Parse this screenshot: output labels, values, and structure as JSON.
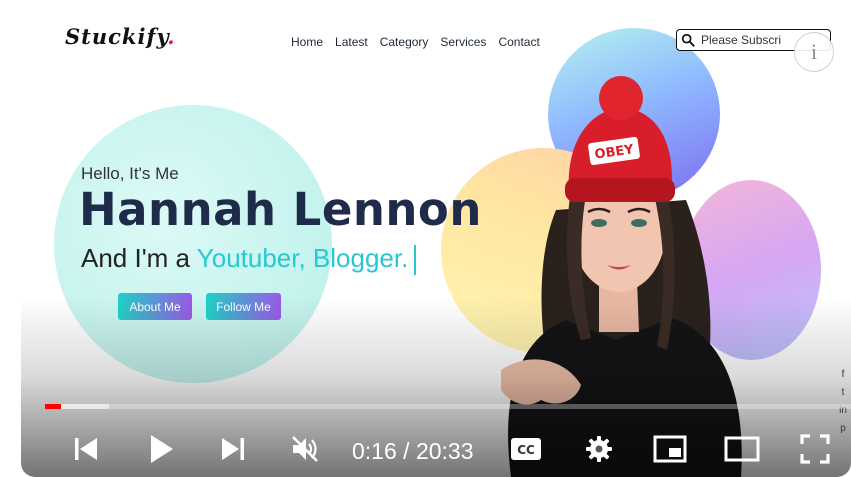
{
  "brand": {
    "logo_text": "Stuckify",
    "logo_dot": "."
  },
  "nav": {
    "items": [
      "Home",
      "Latest",
      "Category",
      "Services",
      "Contact"
    ]
  },
  "search": {
    "value": "Please Subscri",
    "icon": "search-icon"
  },
  "hero": {
    "greeting": "Hello, It's Me",
    "name": "Hannah Lennon",
    "role_prefix": "And I'm a ",
    "role_highlight": "Youtuber, Blogger.",
    "buttons": {
      "about": "About Me",
      "follow": "Follow Me"
    }
  },
  "player": {
    "time_current": "0:16",
    "time_separator": " / ",
    "time_total": "20:33",
    "progress_played_fraction": 0.02,
    "progress_buffered_fraction": 0.08,
    "cc_label": "CC",
    "controls": [
      "previous-icon",
      "play-icon",
      "next-icon",
      "mute-icon",
      "cc-icon",
      "settings-icon",
      "miniplayer-icon",
      "theater-icon",
      "fullscreen-icon"
    ]
  },
  "social": [
    "f",
    "t",
    "in",
    "p"
  ],
  "colors": {
    "accent": "#28c8d2",
    "title": "#1e2b4a",
    "progress": "#ff0000",
    "button_start": "#1fd1c6",
    "button_end": "#9b59e6"
  }
}
